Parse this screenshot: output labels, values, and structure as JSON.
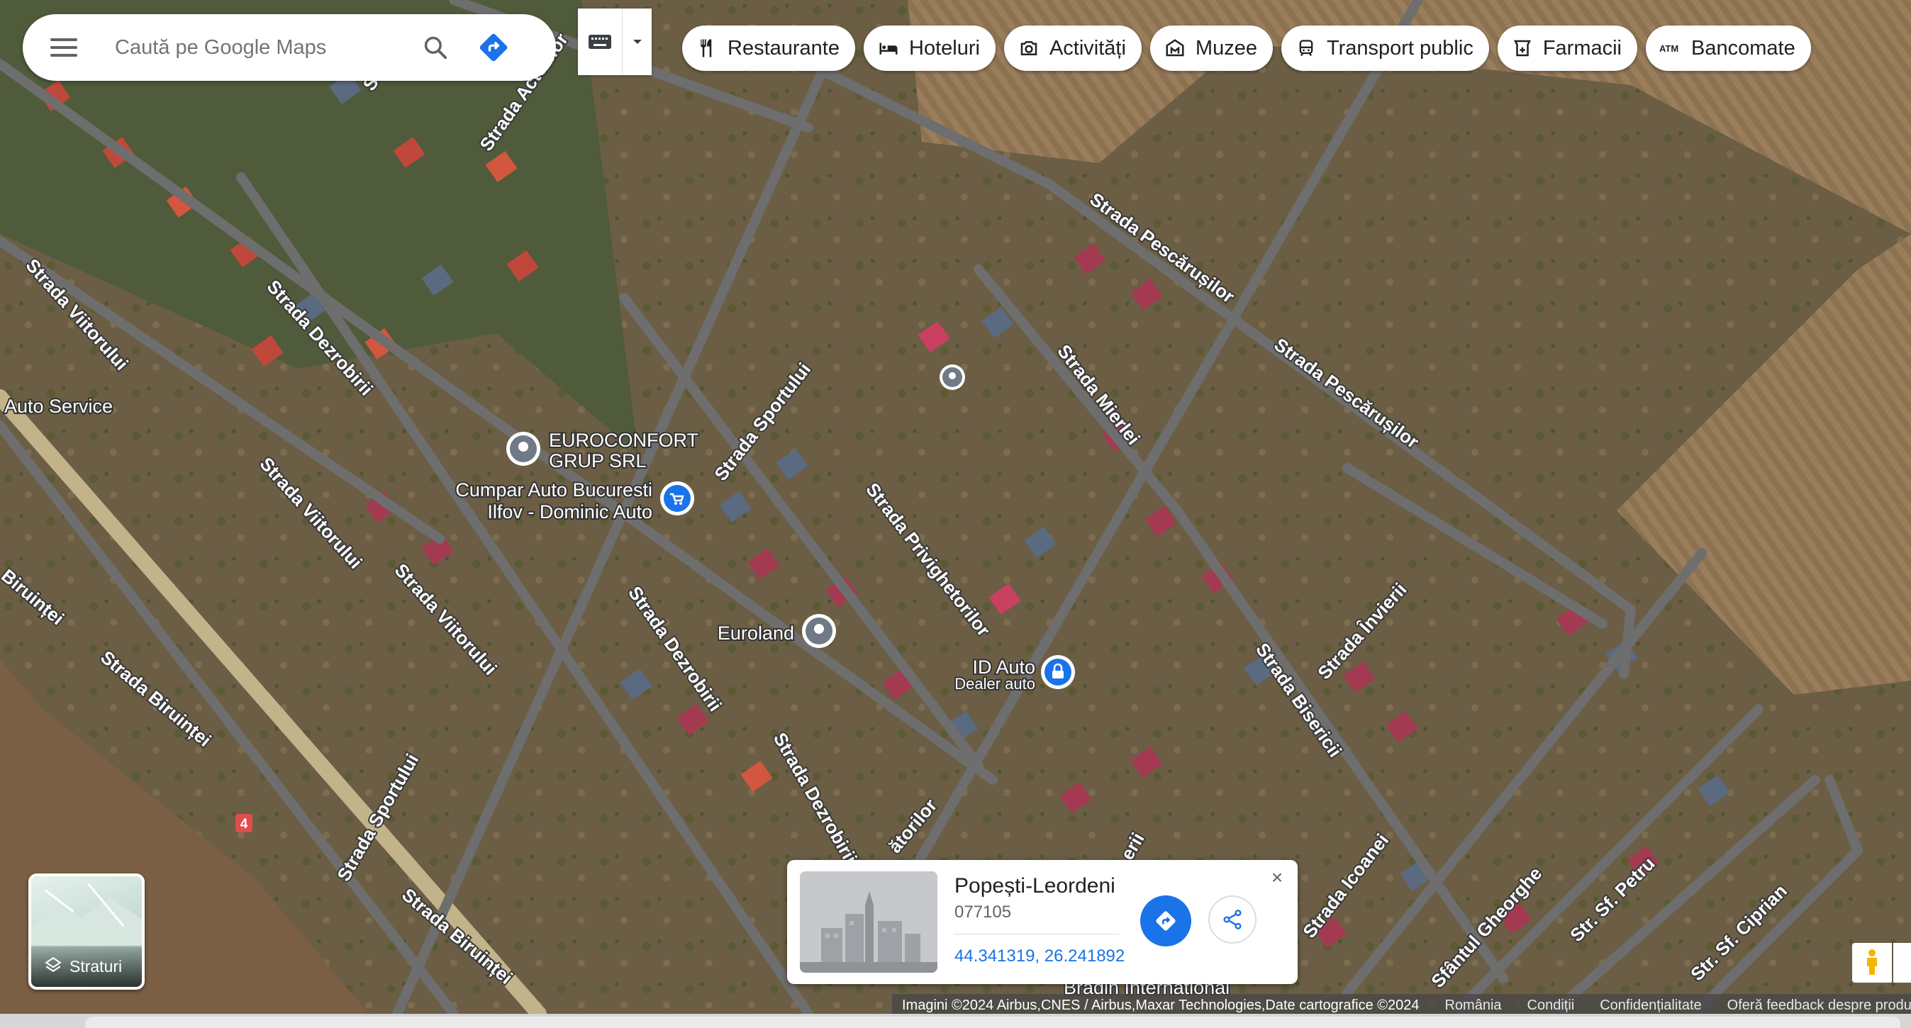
{
  "search": {
    "placeholder": "Caută pe Google Maps"
  },
  "chips": [
    {
      "label": "Restaurante",
      "icon": "fork-knife-icon"
    },
    {
      "label": "Hoteluri",
      "icon": "bed-icon"
    },
    {
      "label": "Activități",
      "icon": "camera-icon"
    },
    {
      "label": "Muzee",
      "icon": "museum-icon"
    },
    {
      "label": "Transport public",
      "icon": "train-icon"
    },
    {
      "label": "Farmacii",
      "icon": "pharmacy-icon"
    },
    {
      "label": "Bancomate",
      "icon": "atm-icon"
    }
  ],
  "map": {
    "roads": [
      "Strada Actorilor",
      "Strada Viitorului",
      "Strada Dezrobirii",
      "Strada Sportului",
      "Strada Privighetorilor",
      "Strada Mierlei",
      "Strada Pescărușilor",
      "Strada Învierii",
      "Strada Bisericii",
      "Strada Icoanei",
      "Strada Biruinței",
      "Biruinței",
      "Str. Sf. Petru",
      "Str. Sf. Ciprian",
      "Sfântul Gheorghe",
      "Stra",
      "ătorilor",
      "erii"
    ],
    "road_number": "4",
    "places": {
      "auto_service": "Auto Service",
      "euroconfort": [
        "EUROCONFORT",
        "GRUP SRL"
      ],
      "cumpar_auto": [
        "Cumpar Auto Bucuresti",
        "Ilfov - Dominic Auto"
      ],
      "euroland": "Euroland",
      "id_auto": "ID Auto",
      "id_auto_sub": "Dealer auto",
      "bradin": "Bradin International"
    }
  },
  "layers": {
    "label": "Straturi"
  },
  "card": {
    "title": "Popești-Leordeni",
    "postal": "077105",
    "coords": "44.341319, 26.241892"
  },
  "footer": {
    "imagery": "Imagini ©2024 Airbus,CNES / Airbus,Maxar Technologies,Date cartografice ©2024",
    "country": "România",
    "terms": "Condiții",
    "privacy": "Confidențialitate",
    "feedback": "Oferă feedback despre produs"
  },
  "colors": {
    "accent": "#1a73e8",
    "chip_bg": "#ffffff",
    "field": "#7a6a4a",
    "roof": "#c0483a"
  }
}
